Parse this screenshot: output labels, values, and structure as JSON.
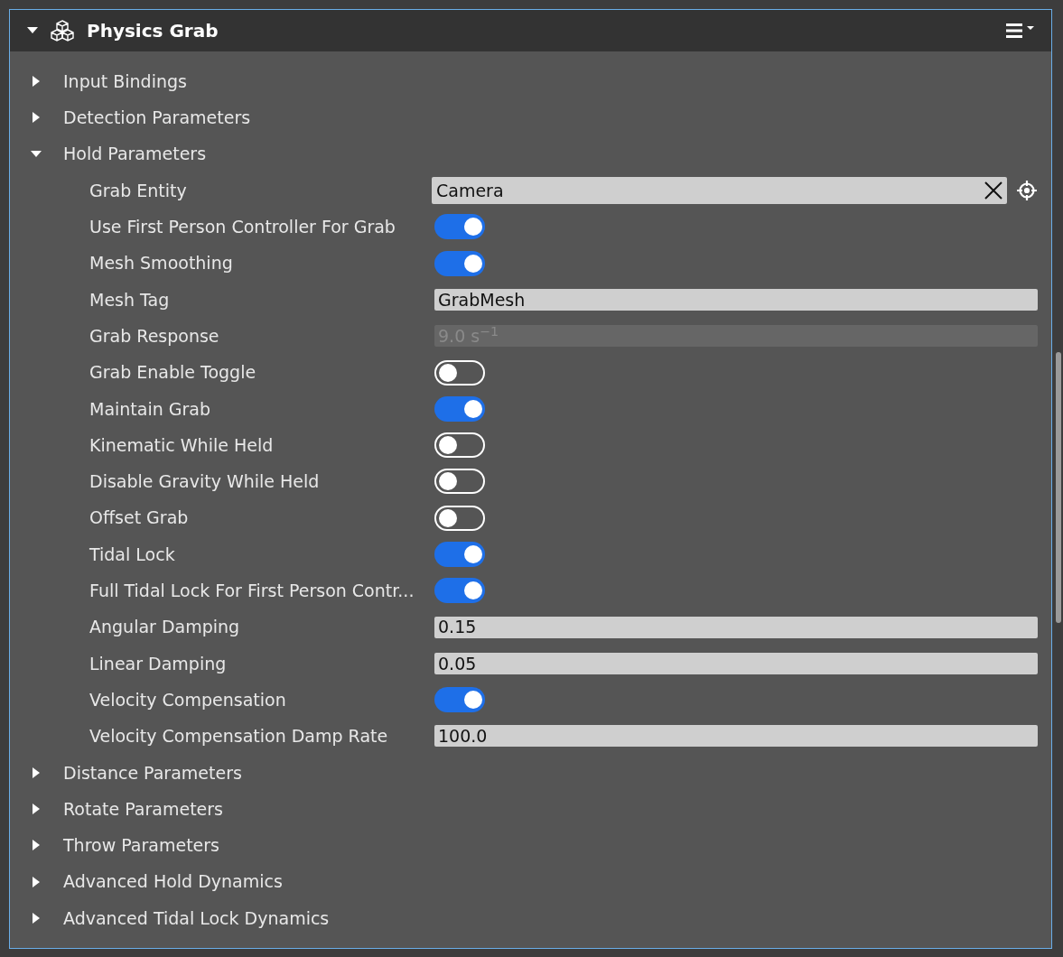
{
  "panel": {
    "title": "Physics Grab",
    "expanded": true
  },
  "sections": [
    {
      "label": "Input Bindings",
      "expanded": false
    },
    {
      "label": "Detection Parameters",
      "expanded": false
    },
    {
      "label": "Hold Parameters",
      "expanded": true,
      "properties": [
        {
          "label": "Grab Entity",
          "kind": "entity",
          "value": "Camera"
        },
        {
          "label": "Use First Person Controller For Grab",
          "kind": "toggle",
          "on": true
        },
        {
          "label": "Mesh Smoothing",
          "kind": "toggle",
          "on": true
        },
        {
          "label": "Mesh Tag",
          "kind": "text",
          "value": "GrabMesh",
          "disabled": false
        },
        {
          "label": "Grab Response",
          "kind": "text",
          "value": "9.0 s$^{−1}$",
          "disabled": true
        },
        {
          "label": "Grab Enable Toggle",
          "kind": "toggle",
          "on": false
        },
        {
          "label": "Maintain Grab",
          "kind": "toggle",
          "on": true
        },
        {
          "label": "Kinematic While Held",
          "kind": "toggle",
          "on": false
        },
        {
          "label": "Disable Gravity While Held",
          "kind": "toggle",
          "on": false
        },
        {
          "label": "Offset Grab",
          "kind": "toggle",
          "on": false
        },
        {
          "label": "Tidal Lock",
          "kind": "toggle",
          "on": true
        },
        {
          "label": "Full Tidal Lock For First Person Contr...",
          "kind": "toggle",
          "on": true
        },
        {
          "label": "Angular Damping",
          "kind": "text",
          "value": "0.15",
          "disabled": false
        },
        {
          "label": "Linear Damping",
          "kind": "text",
          "value": "0.05",
          "disabled": false
        },
        {
          "label": "Velocity Compensation",
          "kind": "toggle",
          "on": true
        },
        {
          "label": "Velocity Compensation Damp Rate",
          "kind": "text",
          "value": "100.0",
          "disabled": false
        }
      ]
    },
    {
      "label": "Distance Parameters",
      "expanded": false
    },
    {
      "label": "Rotate Parameters",
      "expanded": false
    },
    {
      "label": "Throw Parameters",
      "expanded": false
    },
    {
      "label": "Advanced Hold Dynamics",
      "expanded": false
    },
    {
      "label": "Advanced Tidal Lock Dynamics",
      "expanded": false
    }
  ]
}
